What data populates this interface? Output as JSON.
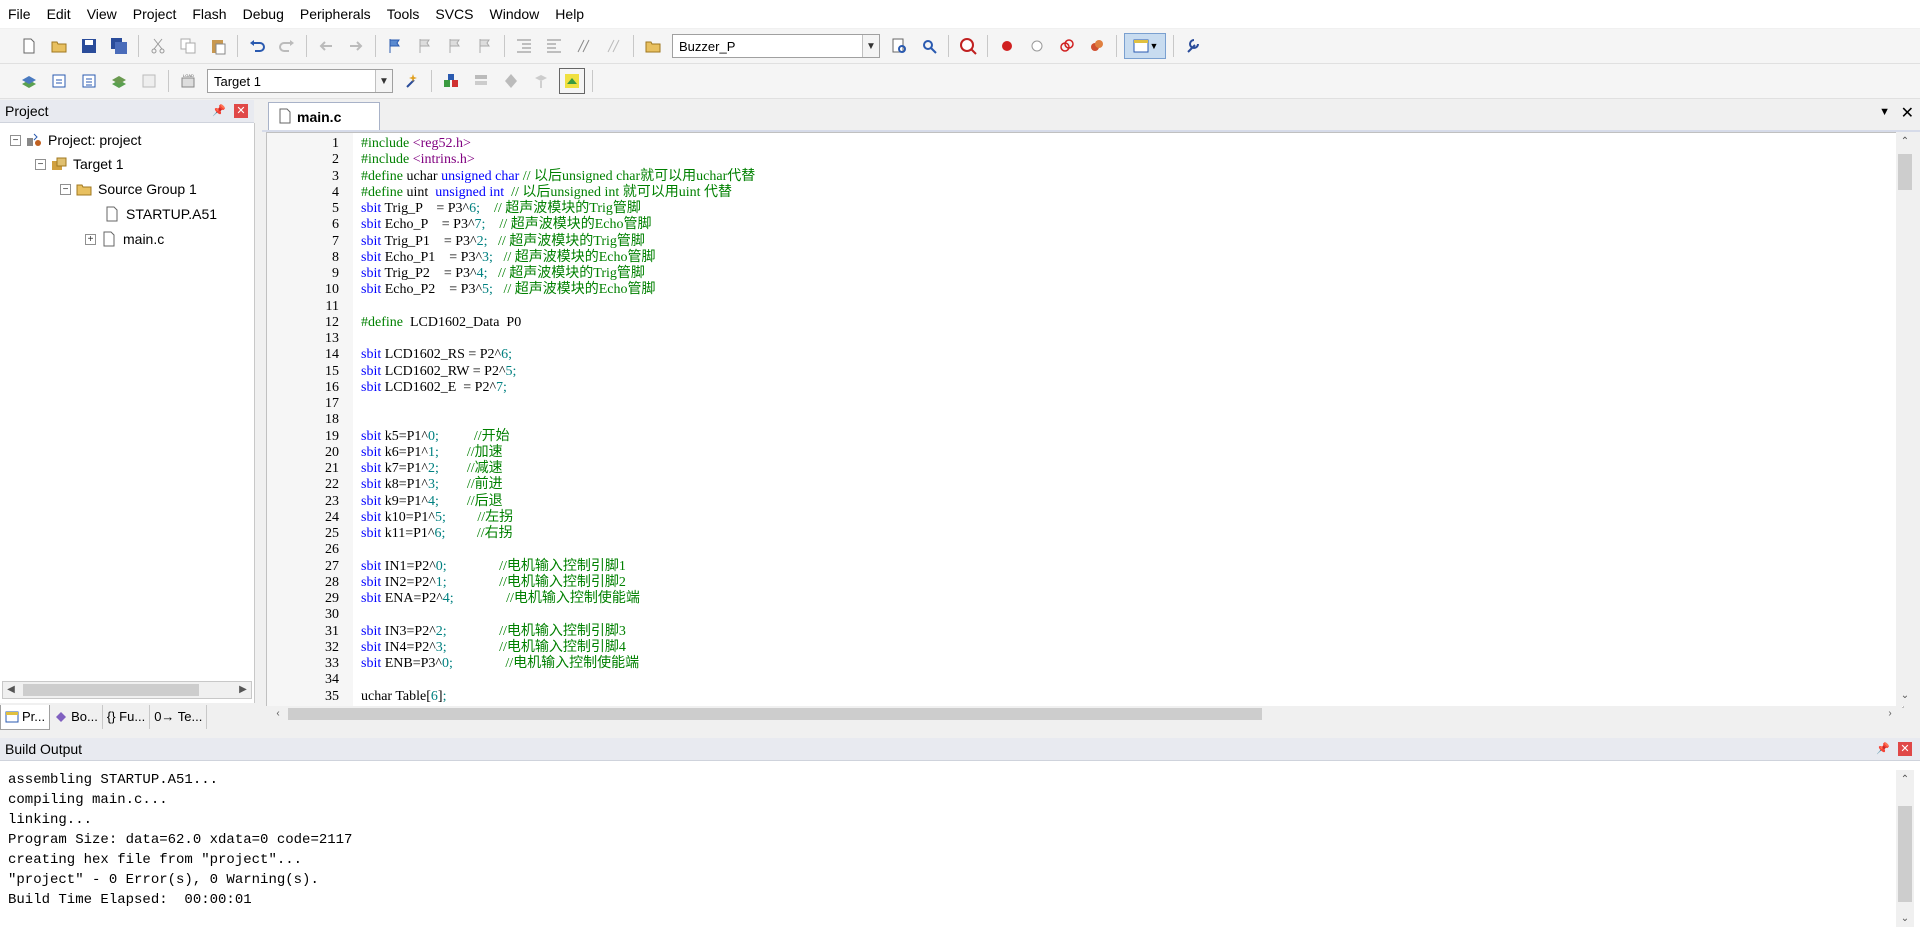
{
  "menu": [
    "File",
    "Edit",
    "View",
    "Project",
    "Flash",
    "Debug",
    "Peripherals",
    "Tools",
    "SVCS",
    "Window",
    "Help"
  ],
  "toolbar": {
    "target_combo": "Buzzer_P",
    "build_target": "Target 1"
  },
  "project_panel": {
    "title": "Project",
    "tree": [
      {
        "label": "Project: project"
      },
      {
        "label": "Target 1"
      },
      {
        "label": "Source Group 1"
      },
      {
        "label": "STARTUP.A51"
      },
      {
        "label": "main.c"
      }
    ],
    "tabs": [
      "Pr...",
      "Bo...",
      "{} Fu...",
      "0→ Te..."
    ]
  },
  "editor": {
    "tab": "main.c",
    "lines": [
      {
        "n": "1",
        "t": "#include <reg52.h>"
      },
      {
        "n": "2",
        "t": "#include <intrins.h>"
      },
      {
        "n": "3",
        "t": "#define uchar unsigned char // 以后unsigned char就可以用uchar代替"
      },
      {
        "n": "4",
        "t": "#define uint  unsigned int  // 以后unsigned int 就可以用uint 代替"
      },
      {
        "n": "5",
        "t": "sbit Trig_P    = P3^6;    // 超声波模块的Trig管脚"
      },
      {
        "n": "6",
        "t": "sbit Echo_P    = P3^7;    // 超声波模块的Echo管脚"
      },
      {
        "n": "7",
        "t": "sbit Trig_P1    = P3^2;   // 超声波模块的Trig管脚"
      },
      {
        "n": "8",
        "t": "sbit Echo_P1    = P3^3;   // 超声波模块的Echo管脚"
      },
      {
        "n": "9",
        "t": "sbit Trig_P2    = P3^4;   // 超声波模块的Trig管脚"
      },
      {
        "n": "10",
        "t": "sbit Echo_P2    = P3^5;   // 超声波模块的Echo管脚"
      },
      {
        "n": "11",
        "t": ""
      },
      {
        "n": "12",
        "t": "#define  LCD1602_Data  P0"
      },
      {
        "n": "13",
        "t": ""
      },
      {
        "n": "14",
        "t": "sbit LCD1602_RS = P2^6;"
      },
      {
        "n": "15",
        "t": "sbit LCD1602_RW = P2^5;"
      },
      {
        "n": "16",
        "t": "sbit LCD1602_E  = P2^7;"
      },
      {
        "n": "17",
        "t": ""
      },
      {
        "n": "18",
        "t": ""
      },
      {
        "n": "19",
        "t": "sbit k5=P1^0;          //开始"
      },
      {
        "n": "20",
        "t": "sbit k6=P1^1;        //加速"
      },
      {
        "n": "21",
        "t": "sbit k7=P1^2;        //减速"
      },
      {
        "n": "22",
        "t": "sbit k8=P1^3;        //前进"
      },
      {
        "n": "23",
        "t": "sbit k9=P1^4;        //后退"
      },
      {
        "n": "24",
        "t": "sbit k10=P1^5;         //左拐"
      },
      {
        "n": "25",
        "t": "sbit k11=P1^6;         //右拐"
      },
      {
        "n": "26",
        "t": ""
      },
      {
        "n": "27",
        "t": "sbit IN1=P2^0;               //电机输入控制引脚1"
      },
      {
        "n": "28",
        "t": "sbit IN2=P2^1;               //电机输入控制引脚2"
      },
      {
        "n": "29",
        "t": "sbit ENA=P2^4;               //电机输入控制使能端"
      },
      {
        "n": "30",
        "t": ""
      },
      {
        "n": "31",
        "t": "sbit IN3=P2^2;               //电机输入控制引脚3"
      },
      {
        "n": "32",
        "t": "sbit IN4=P2^3;               //电机输入控制引脚4"
      },
      {
        "n": "33",
        "t": "sbit ENB=P3^0;               //电机输入控制使能端"
      },
      {
        "n": "34",
        "t": ""
      },
      {
        "n": "35",
        "t": "uchar Table[6];"
      }
    ]
  },
  "build_output": {
    "title": "Build Output",
    "lines": [
      "assembling STARTUP.A51...",
      "compiling main.c...",
      "linking...",
      "Program Size: data=62.0 xdata=0 code=2117",
      "creating hex file from \"project\"...",
      "\"project\" - 0 Error(s), 0 Warning(s).",
      "Build Time Elapsed:  00:00:01"
    ]
  }
}
